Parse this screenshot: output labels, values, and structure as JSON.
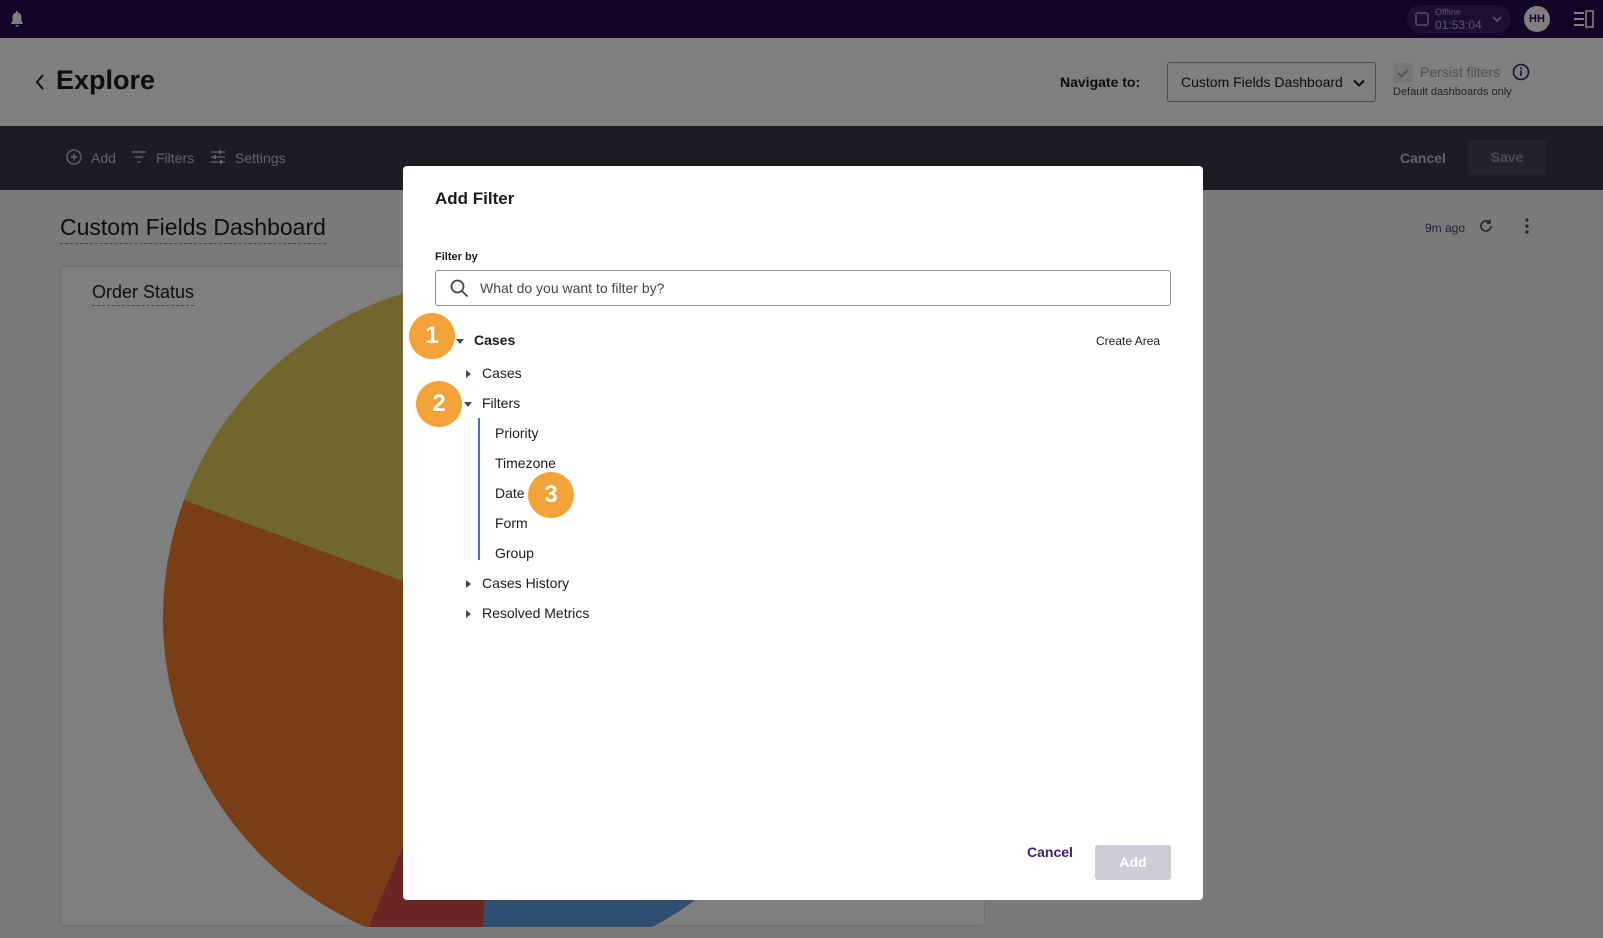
{
  "topbar": {
    "status_label": "Offline",
    "status_time": "01:53:04",
    "avatar_initials": "HH"
  },
  "header": {
    "title": "Explore",
    "navigate_label": "Navigate to:",
    "navigate_value": "Custom Fields Dashboard",
    "persist_label": "Persist filters",
    "persist_sub": "Default dashboards only"
  },
  "toolbar": {
    "add_label": "Add",
    "filters_label": "Filters",
    "settings_label": "Settings",
    "cancel_label": "Cancel",
    "save_label": "Save"
  },
  "dashboard": {
    "title": "Custom Fields Dashboard",
    "updated": "9m ago",
    "card_title": "Order Status"
  },
  "modal": {
    "title": "Add Filter",
    "filter_by_label": "Filter by",
    "search_placeholder": "What do you want to filter by?",
    "create_area": "Create Area",
    "tree": {
      "root": "Cases",
      "cases": "Cases",
      "filters": "Filters",
      "filter_items": [
        "Priority",
        "Timezone",
        "Date",
        "Form",
        "Group"
      ],
      "cases_history": "Cases History",
      "resolved_metrics": "Resolved Metrics"
    },
    "cancel_label": "Cancel",
    "add_label": "Add"
  },
  "markers": [
    "1",
    "2",
    "3"
  ],
  "colors": {
    "topbar": "#26094f",
    "accent": "#3c1f73",
    "marker": "#f3a338",
    "tree_guide": "#3f6fd8"
  }
}
